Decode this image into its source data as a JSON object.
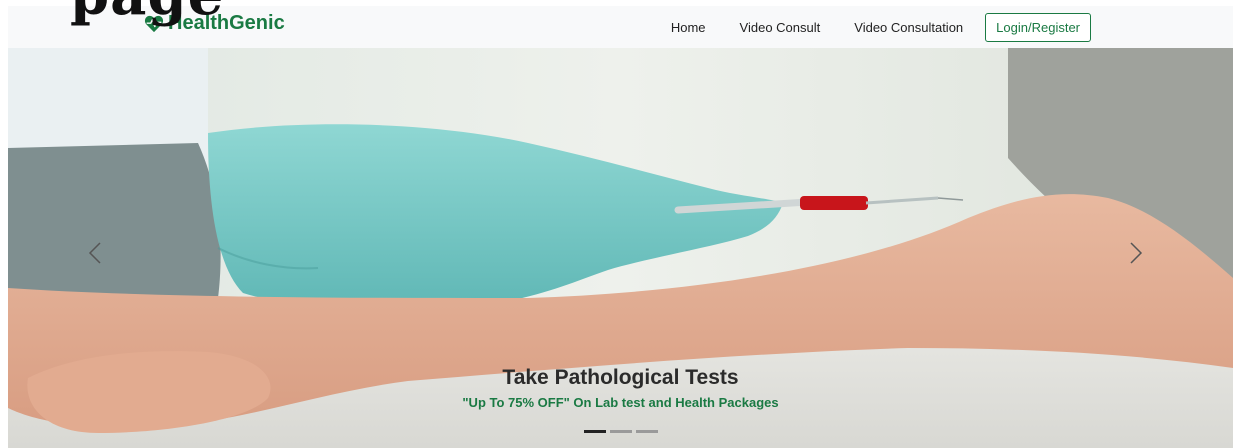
{
  "page_heading_cut": "page",
  "navbar": {
    "brand": "HealthGenic",
    "links": [
      "Home",
      "Video Consult",
      "Video Consultation"
    ],
    "login_label": "Login/Register",
    "brand_color": "#1a7a43"
  },
  "carousel": {
    "caption_title": "Take Pathological Tests",
    "caption_subtitle": "\"Up To 75% OFF\" On Lab test and Health Packages",
    "indicator_count": 3,
    "active_indicator": 0
  },
  "icons": {
    "brand": "heartbeat-icon",
    "prev": "chevron-left-icon",
    "next": "chevron-right-icon"
  }
}
